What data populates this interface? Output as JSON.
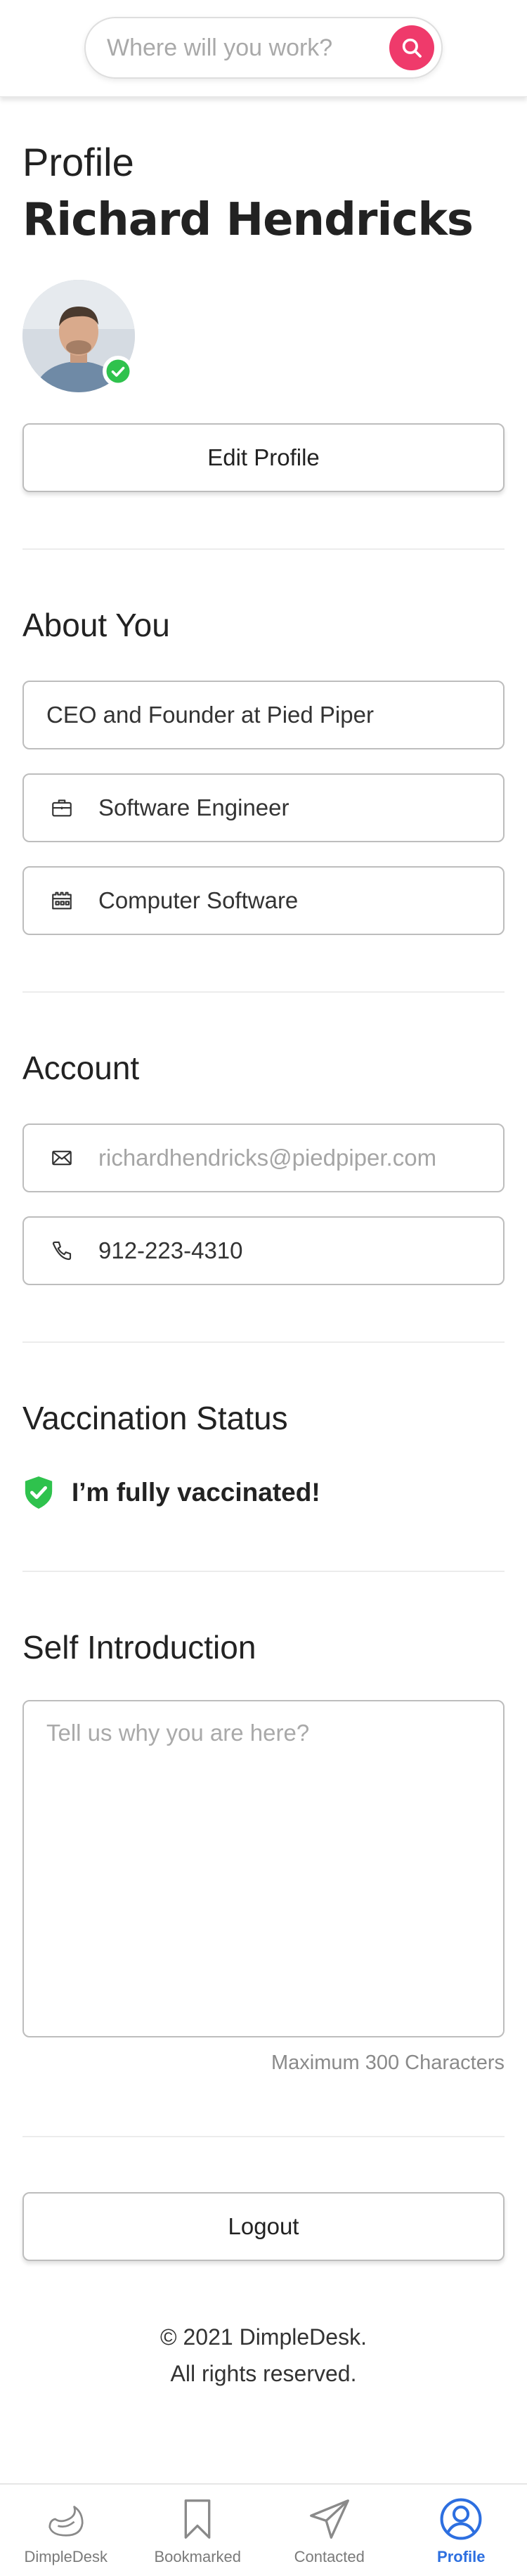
{
  "header": {
    "search_placeholder": "Where will you work?"
  },
  "profile": {
    "label": "Profile",
    "name": "Richard Hendricks",
    "edit_button": "Edit Profile"
  },
  "about": {
    "title": "About You",
    "headline": "CEO and Founder at Pied Piper",
    "job_title": "Software Engineer",
    "industry": "Computer Software"
  },
  "account": {
    "title": "Account",
    "email": "richardhendricks@piedpiper.com",
    "phone": "912-223-4310"
  },
  "vaccination": {
    "title": "Vaccination Status",
    "status": "I’m fully vaccinated!"
  },
  "intro": {
    "title": "Self Introduction",
    "placeholder": "Tell us why you are here?",
    "max_note": "Maximum 300 Characters"
  },
  "logout_label": "Logout",
  "footer": {
    "copyright": "© 2021 DimpleDesk.",
    "rights": "All rights reserved."
  },
  "nav": {
    "items": [
      {
        "label": "DimpleDesk",
        "icon": "dimpledesk-logo-icon"
      },
      {
        "label": "Bookmarked",
        "icon": "bookmark-icon"
      },
      {
        "label": "Contacted",
        "icon": "paper-plane-icon"
      },
      {
        "label": "Profile",
        "icon": "user-circle-icon"
      }
    ],
    "active": "Profile"
  },
  "colors": {
    "accent_pink": "#ef3a6b",
    "verified_green": "#2fc24d",
    "active_blue": "#2d6fe0"
  }
}
